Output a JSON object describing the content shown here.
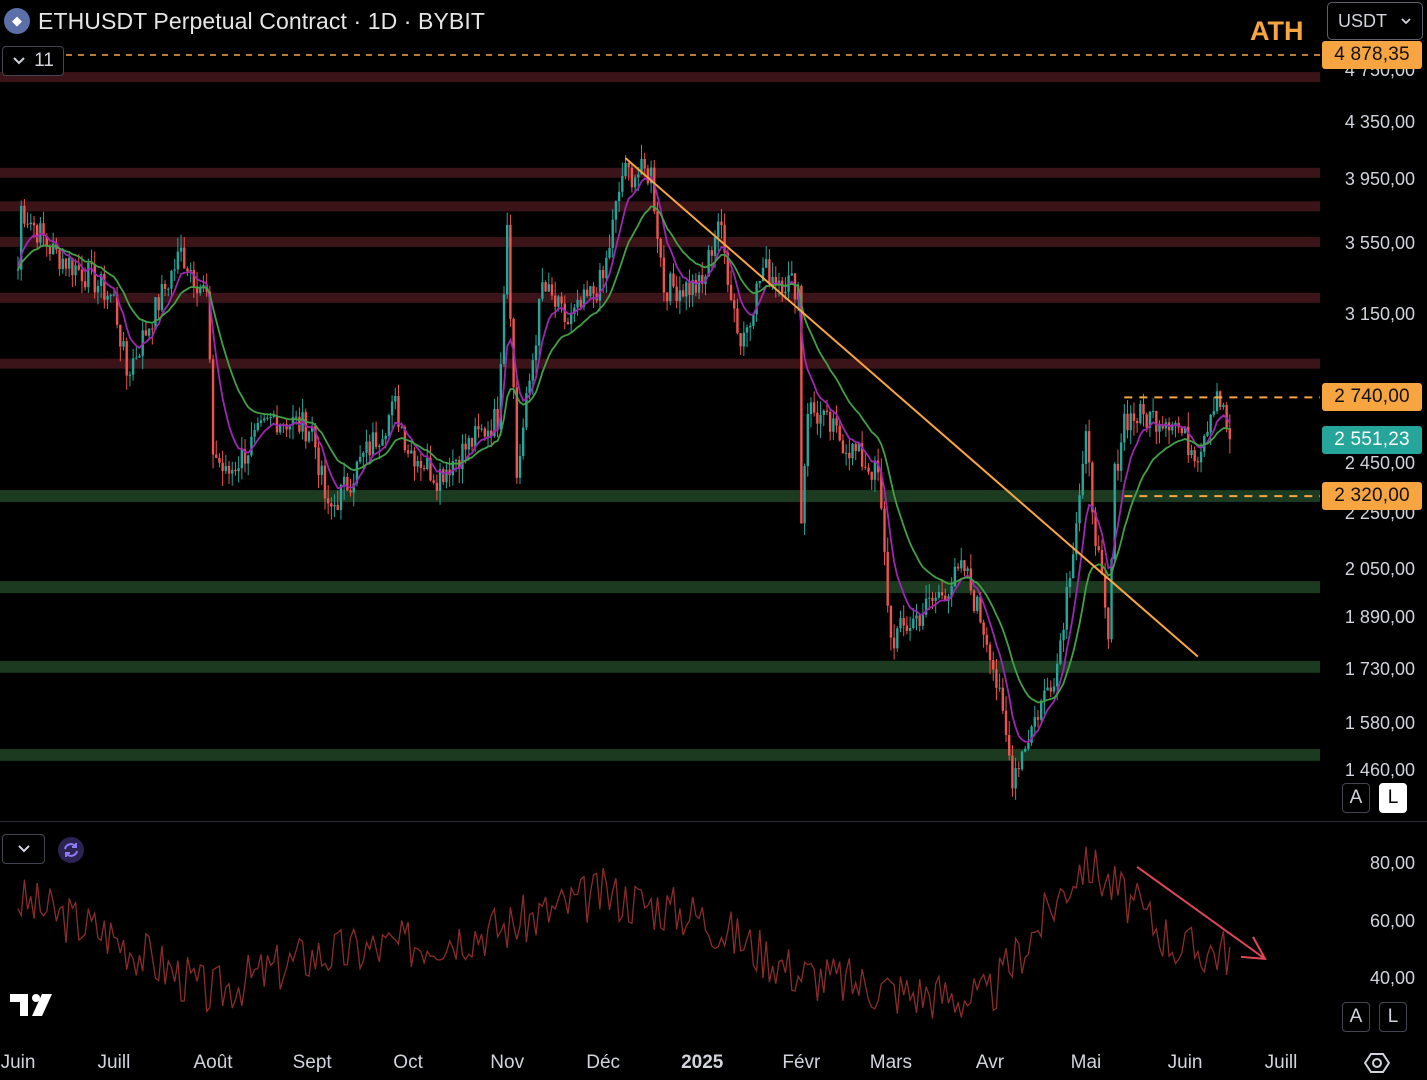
{
  "header": {
    "symbol_logo": "eth-icon",
    "title": "ETHUSDT Perpetual Contract · 1D · BYBIT",
    "collapse_count": "11",
    "currency": "USDT",
    "ath_label": "ATH"
  },
  "price_axis": {
    "labels": [
      "4 750,00",
      "4 350,00",
      "3 950,00",
      "3 550,00",
      "3 150,00",
      "2 450,00",
      "2 250,00",
      "2 050,00",
      "1 890,00",
      "1 730,00",
      "1 580,00",
      "1 460,00"
    ],
    "badges": [
      {
        "value": "4 878,35",
        "color": "#f7a541"
      },
      {
        "value": "2 740,00",
        "color": "#f7a541"
      },
      {
        "value": "2 551,23",
        "color": "#26a69a"
      },
      {
        "value": "2 320,00",
        "color": "#f7a541"
      }
    ],
    "scale_buttons": [
      "A",
      "L"
    ]
  },
  "rsi_axis": {
    "labels": [
      "80,00",
      "60,00",
      "40,00"
    ],
    "scale_buttons": [
      "A",
      "L"
    ]
  },
  "time_axis": {
    "labels": [
      "Juin",
      "Juill",
      "Août",
      "Sept",
      "Oct",
      "Nov",
      "Déc",
      "2025",
      "Févr",
      "Mars",
      "Avr",
      "Mai",
      "Juin",
      "Juill"
    ]
  },
  "chart_data": {
    "type": "candlestick",
    "log_scale": true,
    "price_range": [
      1400,
      4950
    ],
    "rsi_range": [
      20,
      90
    ],
    "series": [
      {
        "type": "candlestick",
        "name": "ETHUSDT",
        "monthly_closes": [
          {
            "x": "2024-06",
            "y": 3400
          },
          {
            "x": "2024-07",
            "y": 3230
          },
          {
            "x": "2024-08",
            "y": 2510
          },
          {
            "x": "2024-09",
            "y": 2600
          },
          {
            "x": "2024-10",
            "y": 2520
          },
          {
            "x": "2024-11",
            "y": 3700
          },
          {
            "x": "2024-12",
            "y": 3340
          },
          {
            "x": "2025-01",
            "y": 3300
          },
          {
            "x": "2025-02",
            "y": 2240
          },
          {
            "x": "2025-03",
            "y": 1820
          },
          {
            "x": "2025-04",
            "y": 1800
          },
          {
            "x": "2025-05",
            "y": 2530
          },
          {
            "x": "2025-06",
            "y": 2551.23
          }
        ]
      },
      {
        "type": "line",
        "name": "RSI",
        "values": [
          68,
          55,
          35,
          48,
          52,
          58,
          70,
          62,
          42,
          36,
          33,
          82,
          50
        ]
      }
    ],
    "resistance_zones": [
      4700,
      4000,
      3780,
      3560,
      3240,
      2900
    ],
    "support_zones": [
      2320,
      1990,
      1740,
      1500
    ],
    "key_levels": {
      "ath": 4878.35,
      "range_high": 2740,
      "range_low": 2320,
      "last": 2551.23
    },
    "trendline": {
      "from": {
        "x": "2024-12-08",
        "y": 4100
      },
      "to": {
        "x": "2025-06-05",
        "y": 1770
      }
    },
    "rsi_arrow": "down"
  }
}
